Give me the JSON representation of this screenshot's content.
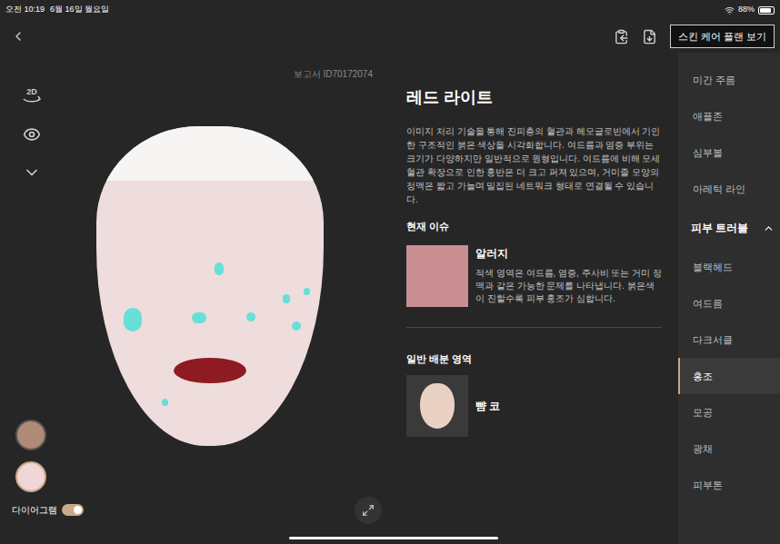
{
  "status_bar": {
    "time": "오전 10:19",
    "date": "6월 16일 월요일",
    "battery": "88%",
    "battery_level": 0.88
  },
  "header": {
    "button": "스킨 케어 플랜 보기"
  },
  "viewer": {
    "report_id": "보고서 ID70172074",
    "view_mode": "2D",
    "thumbnails": [
      {
        "selected": false
      },
      {
        "selected": true
      }
    ],
    "diagram": {
      "label": "다이어그램",
      "on": true
    }
  },
  "detail": {
    "title": "레드 라이트",
    "description": "이미지 처리 기술을 통해 진피층의 혈관과 헤모글로빈에서 기인한 구조적인 붉은 색상을 시각화합니다. 여드름과 염증 부위는 크기가 다양하지만 일반적으로 원형입니다. 여드름에 비해 모세혈관 확장으로 인한 홍반은 더 크고 퍼져 있으며, 거미줄 모양의 정맥은 짧고 가늘며 밀집된 네트워크 형태로 연결될 수 있습니다.",
    "current_issue_heading": "현재 이슈",
    "issue": {
      "title": "알러지",
      "description": "적색 영역은 여드름, 염증, 주사비 또는 거미 정맥과 같은 가능한 문제를 나타냅니다. 붉은색이 진할수록 피부 홍조가 심합니다."
    },
    "area_heading": "일반 배분 영역",
    "area": "뺨 코"
  },
  "sidebar": {
    "items": [
      {
        "label": "미간 주름",
        "kind": "item",
        "selected": false
      },
      {
        "label": "애플존",
        "kind": "item",
        "selected": false
      },
      {
        "label": "심부볼",
        "kind": "item",
        "selected": false
      },
      {
        "label": "아레턱 라인",
        "kind": "item",
        "selected": false
      },
      {
        "label": "피부 트러블",
        "kind": "section",
        "selected": false,
        "expanded": true
      },
      {
        "label": "블랙헤드",
        "kind": "item",
        "selected": false
      },
      {
        "label": "여드름",
        "kind": "item",
        "selected": false
      },
      {
        "label": "다크서클",
        "kind": "item",
        "selected": false
      },
      {
        "label": "홍조",
        "kind": "item",
        "selected": true
      },
      {
        "label": "모공",
        "kind": "item",
        "selected": false
      },
      {
        "label": "광채",
        "kind": "item",
        "selected": false
      },
      {
        "label": "피부톤",
        "kind": "item",
        "selected": false
      }
    ]
  }
}
